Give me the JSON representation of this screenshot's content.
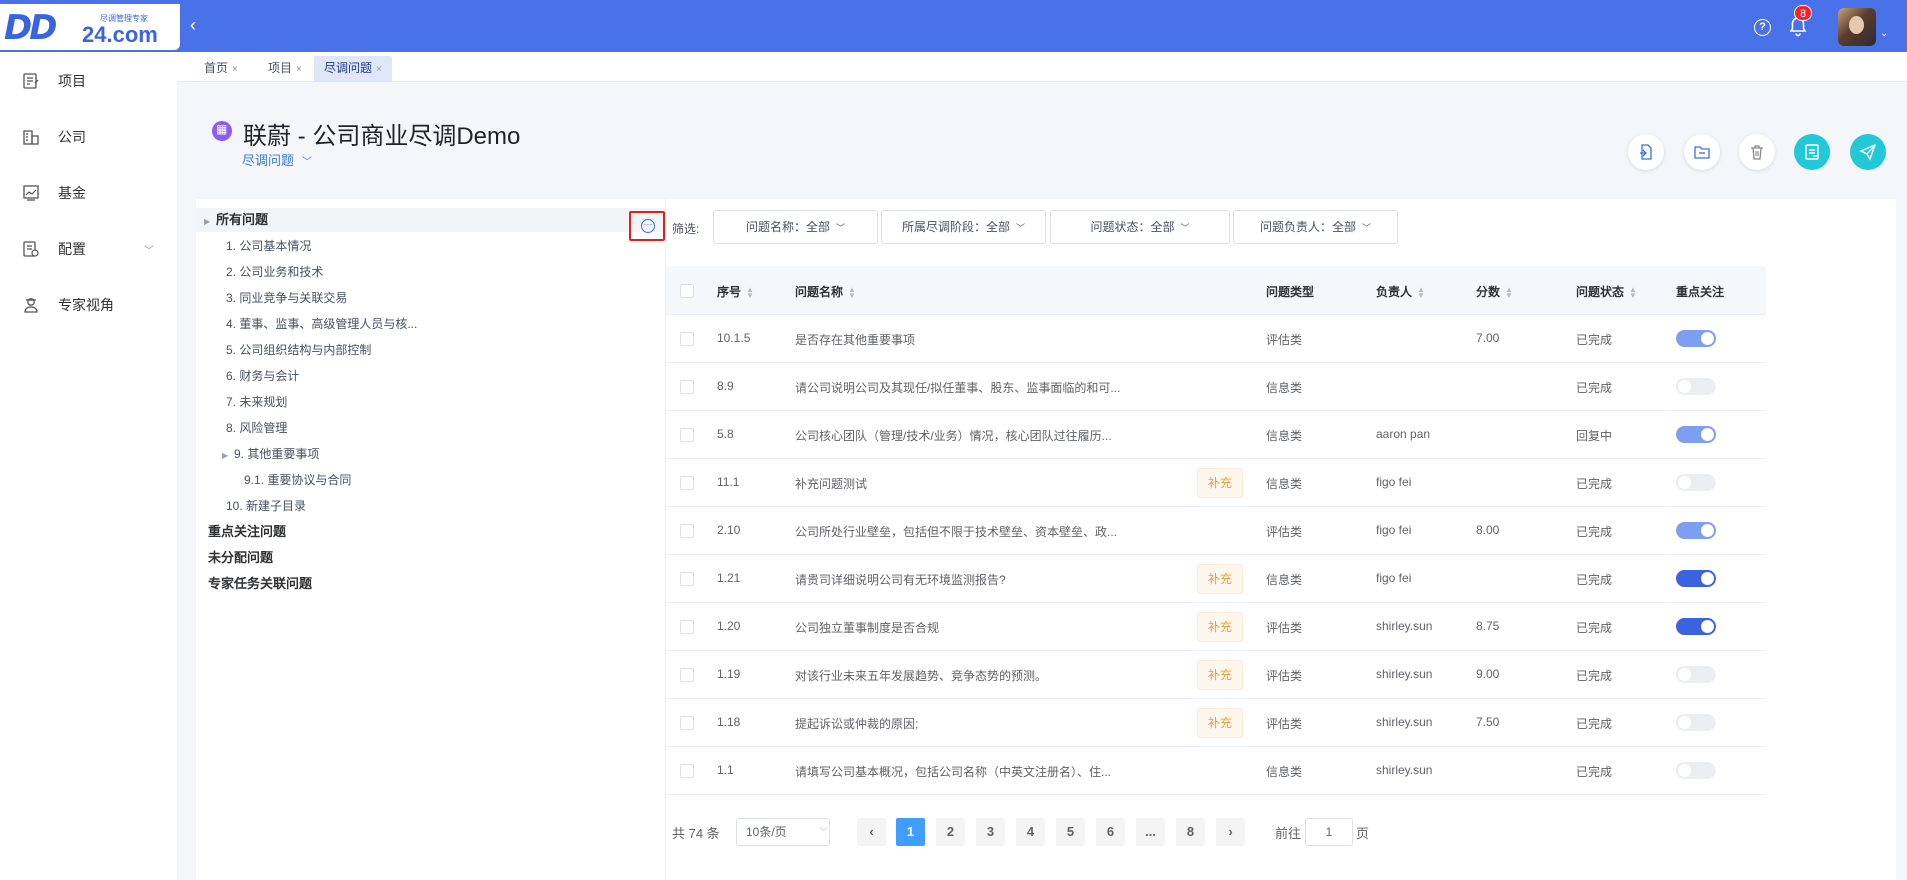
{
  "logo": {
    "mark": "DD",
    "com": "24.com",
    "sub": "尽调管理专家"
  },
  "header": {
    "notif_count": "8"
  },
  "sidebar": {
    "items": [
      {
        "label": "项目"
      },
      {
        "label": "公司"
      },
      {
        "label": "基金"
      },
      {
        "label": "配置"
      },
      {
        "label": "专家视角"
      }
    ]
  },
  "tabs": [
    {
      "label": "首页"
    },
    {
      "label": "项目"
    },
    {
      "label": "尽调问题"
    }
  ],
  "project": {
    "title": "联蔚 - 公司商业尽调Demo",
    "subtitle": "尽调问题"
  },
  "tree": {
    "root": "所有问题",
    "items": [
      "1. 公司基本情况",
      "2. 公司业务和技术",
      "3. 同业竞争与关联交易",
      "4. 董事、监事、高级管理人员与核...",
      "5. 公司组织结构与内部控制",
      "6. 财务与会计",
      "7. 未来规划",
      "8. 风险管理",
      "9. 其他重要事项",
      "9.1. 重要协议与合同",
      "10. 新建子目录"
    ],
    "groups": [
      "重点关注问题",
      "未分配问题",
      "专家任务关联问题"
    ]
  },
  "filters": {
    "label": "筛选:",
    "items": [
      "问题名称：全部",
      "所属尽调阶段：全部",
      "问题状态：全部",
      "问题负责人：全部"
    ]
  },
  "table": {
    "headers": {
      "seq": "序号",
      "name": "问题名称",
      "type": "问题类型",
      "owner": "负责人",
      "score": "分数",
      "status": "问题状态",
      "focus": "重点关注"
    },
    "rows": [
      {
        "seq": "10.1.5",
        "name": "是否存在其他重要事项",
        "tag": "",
        "type": "评估类",
        "owner": "",
        "score": "7.00",
        "status": "已完成",
        "focus": "on-light"
      },
      {
        "seq": "8.9",
        "name": "请公司说明公司及其现任/拟任董事、股东、监事面临的和可...",
        "tag": "",
        "type": "信息类",
        "owner": "",
        "score": "",
        "status": "已完成",
        "focus": "off"
      },
      {
        "seq": "5.8",
        "name": "公司核心团队（管理/技术/业务）情况，核心团队过往履历...",
        "tag": "",
        "type": "信息类",
        "owner": "aaron pan",
        "score": "",
        "status": "回复中",
        "focus": "on-light"
      },
      {
        "seq": "11.1",
        "name": "补充问题测试",
        "tag": "补充",
        "type": "信息类",
        "owner": "figo fei",
        "score": "",
        "status": "已完成",
        "focus": "off"
      },
      {
        "seq": "2.10",
        "name": "公司所处行业壁垒，包括但不限于技术壁垒、资本壁垒、政...",
        "tag": "",
        "type": "评估类",
        "owner": "figo fei",
        "score": "8.00",
        "status": "已完成",
        "focus": "on-light"
      },
      {
        "seq": "1.21",
        "name": "请贵司详细说明公司有无环境监测报告?",
        "tag": "补充",
        "type": "信息类",
        "owner": "figo fei",
        "score": "",
        "status": "已完成",
        "focus": "on-dark"
      },
      {
        "seq": "1.20",
        "name": "公司独立董事制度是否合规",
        "tag": "补充",
        "type": "评估类",
        "owner": "shirley.sun",
        "score": "8.75",
        "status": "已完成",
        "focus": "on-dark"
      },
      {
        "seq": "1.19",
        "name": "对该行业未来五年发展趋势、竞争态势的预测。",
        "tag": "补充",
        "type": "评估类",
        "owner": "shirley.sun",
        "score": "9.00",
        "status": "已完成",
        "focus": "off"
      },
      {
        "seq": "1.18",
        "name": "提起诉讼或仲裁的原因;",
        "tag": "补充",
        "type": "评估类",
        "owner": "shirley.sun",
        "score": "7.50",
        "status": "已完成",
        "focus": "off"
      },
      {
        "seq": "1.1",
        "name": "请填写公司基本概况，包括公司名称（中英文注册名）、住...",
        "tag": "",
        "type": "信息类",
        "owner": "shirley.sun",
        "score": "",
        "status": "已完成",
        "focus": "off"
      }
    ]
  },
  "pagination": {
    "total": "共 74 条",
    "page_size": "10条/页",
    "pages": [
      "1",
      "2",
      "3",
      "4",
      "5",
      "6",
      "...",
      "8"
    ],
    "current": "1",
    "goto_label": "前往",
    "goto_value": "1",
    "goto_unit": "页"
  },
  "colors": {
    "topbar": "#4a72e8",
    "accent": "#409eff",
    "tag_text": "#e6a23c",
    "action_primary": "#23c8d6"
  },
  "icons": {
    "sidebar": [
      "document-edit-icon",
      "building-icon",
      "chart-line-icon",
      "settings-doc-icon",
      "expert-person-icon"
    ],
    "header_actions": [
      "import-file-icon",
      "folder-icon",
      "trash-icon",
      "save-list-icon",
      "send-icon"
    ]
  }
}
